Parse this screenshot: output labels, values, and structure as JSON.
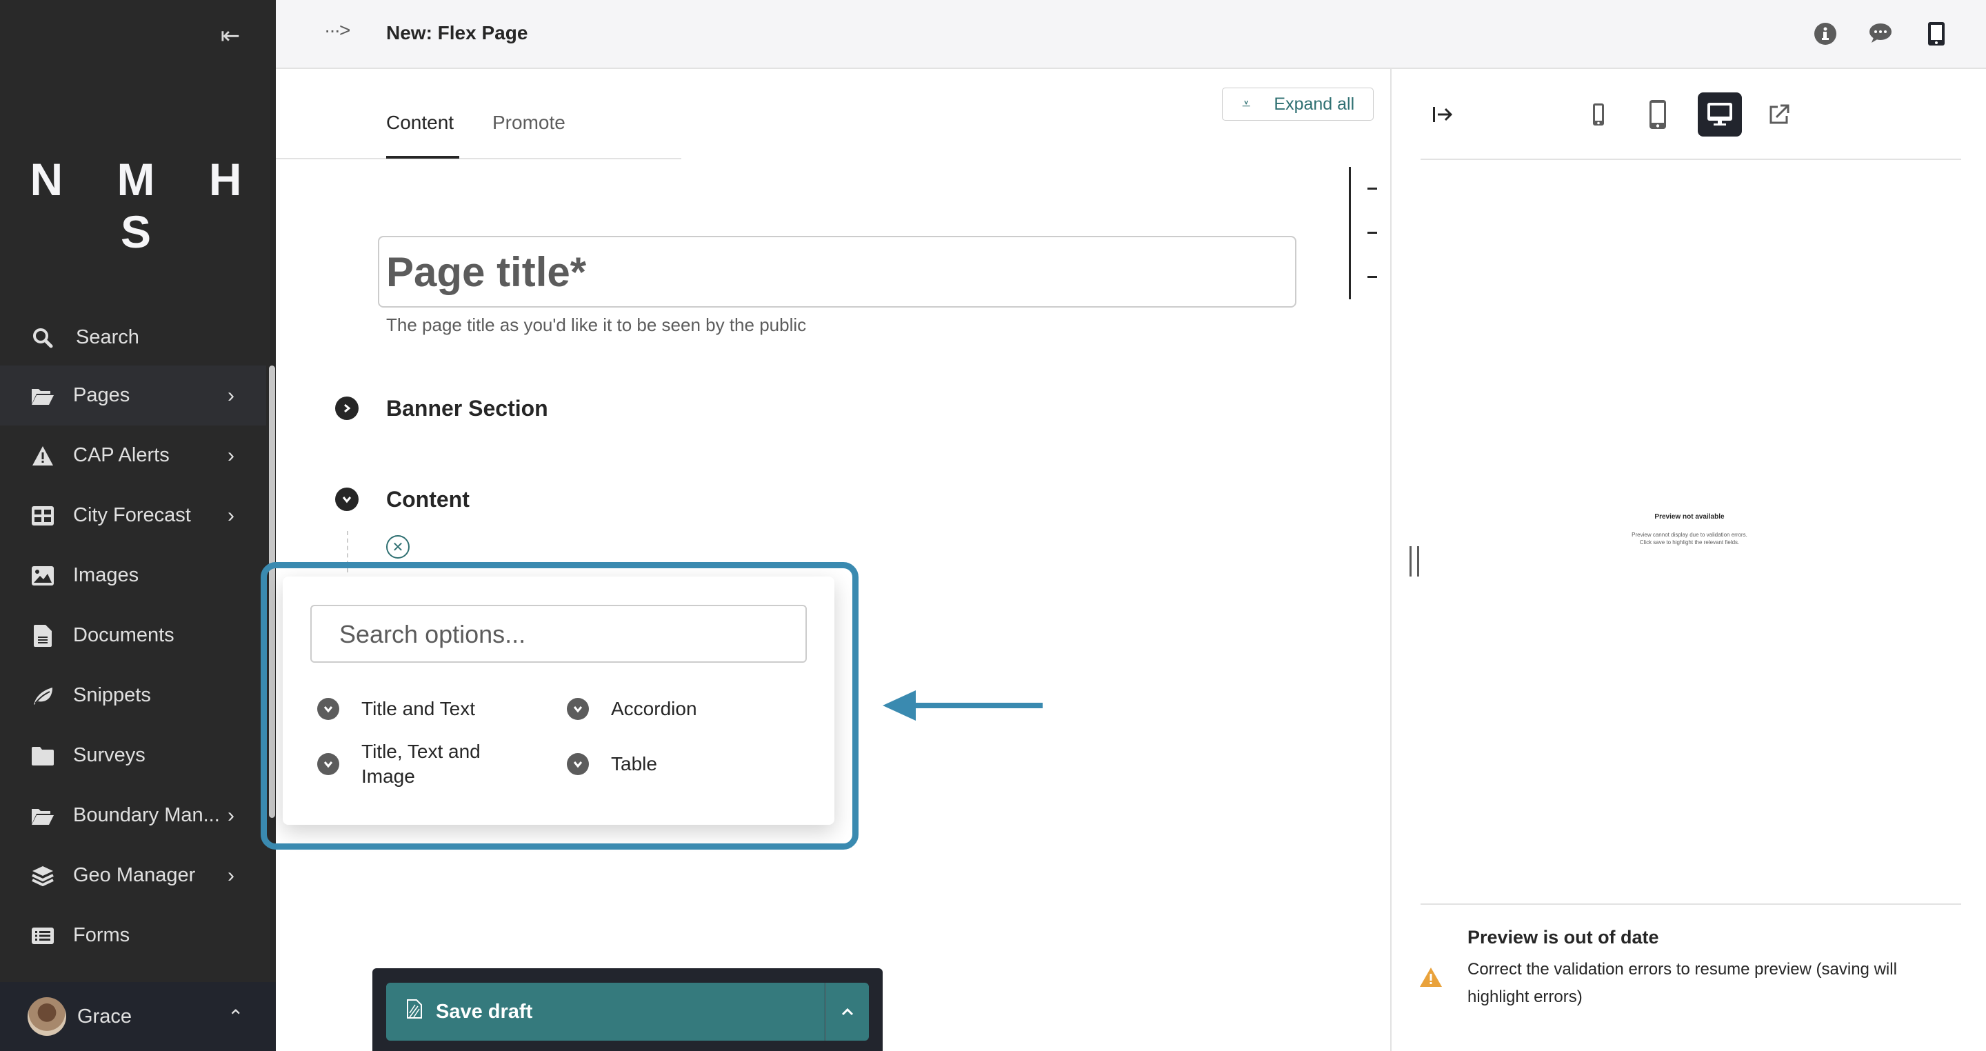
{
  "sidebar": {
    "logo": "N M H S",
    "collapse_icon": "collapse-left-icon",
    "items": [
      {
        "label": "Search",
        "icon": "search-icon",
        "has_submenu": false
      },
      {
        "label": "Pages",
        "icon": "folder-open-icon",
        "has_submenu": true,
        "active": true
      },
      {
        "label": "CAP Alerts",
        "icon": "warning-icon",
        "has_submenu": true
      },
      {
        "label": "City Forecast",
        "icon": "table-icon",
        "has_submenu": true
      },
      {
        "label": "Images",
        "icon": "image-icon",
        "has_submenu": false
      },
      {
        "label": "Documents",
        "icon": "document-icon",
        "has_submenu": false
      },
      {
        "label": "Snippets",
        "icon": "leaf-icon",
        "has_submenu": false
      },
      {
        "label": "Surveys",
        "icon": "folder-icon",
        "has_submenu": false
      },
      {
        "label": "Boundary Man...",
        "icon": "folder-open-icon",
        "has_submenu": true
      },
      {
        "label": "Geo Manager",
        "icon": "layers-icon",
        "has_submenu": true
      },
      {
        "label": "Forms",
        "icon": "list-icon",
        "has_submenu": false
      }
    ],
    "account": {
      "name": "Grace"
    }
  },
  "header": {
    "breadcrumb_toggle": "···>",
    "title": "New: Flex Page",
    "icons": [
      "info-icon",
      "comment-icon",
      "mobile-icon"
    ]
  },
  "editor": {
    "tabs": [
      {
        "label": "Content",
        "active": true
      },
      {
        "label": "Promote",
        "active": false
      }
    ],
    "expand_all_label": "Expand all",
    "page_title": {
      "value": "",
      "placeholder": "Page title*",
      "help_text": "The page title as you'd like it to be seen by the public"
    },
    "sections": [
      {
        "title": "Banner Section",
        "expanded": false
      },
      {
        "title": "Content",
        "expanded": true
      }
    ],
    "block_chooser": {
      "search_placeholder": "Search options...",
      "search_value": "",
      "options": [
        {
          "label": "Title and Text"
        },
        {
          "label": "Accordion"
        },
        {
          "label": "Title, Text and Image"
        },
        {
          "label": "Table"
        }
      ]
    },
    "save": {
      "label": "Save draft",
      "more_icon": "chevron-up-icon"
    }
  },
  "preview": {
    "devices": [
      {
        "name": "mobile",
        "active": false
      },
      {
        "name": "tablet",
        "active": false
      },
      {
        "name": "desktop",
        "active": true
      }
    ],
    "not_available_title": "Preview not available",
    "not_available_text_1": "Preview cannot display due to validation errors.",
    "not_available_text_2": "Click save to highlight the relevant fields.",
    "out_of_date_title": "Preview is out of date",
    "out_of_date_text": "Correct the validation errors to resume preview (saving will highlight errors)"
  },
  "colors": {
    "sidebar_bg": "#292929",
    "accent_teal": "#357a7d",
    "highlight_blue": "#3a8ab0",
    "warning": "#e9a23b"
  }
}
